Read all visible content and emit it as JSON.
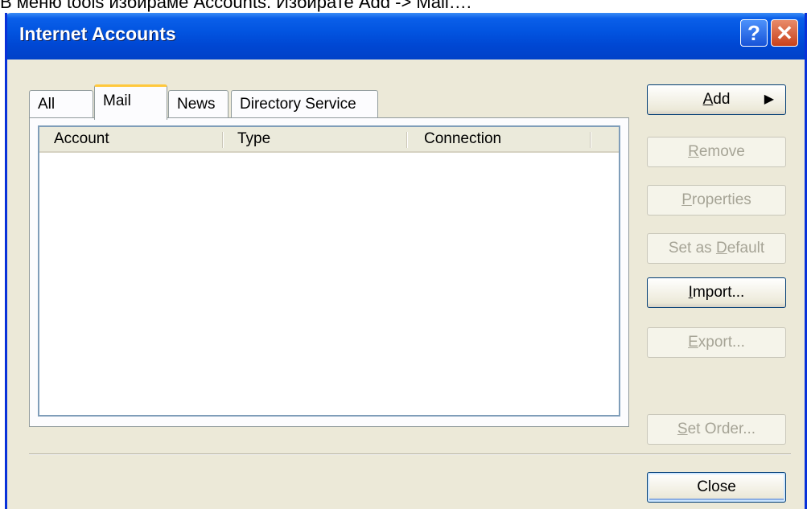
{
  "caption": "В меню tools избираме Accounts. Избирате Add -> Mail….",
  "window": {
    "title": "Internet Accounts",
    "help_glyph": "?",
    "close_glyph": "✕"
  },
  "tabs": [
    {
      "label": "All",
      "active": false
    },
    {
      "label": "Mail",
      "active": true
    },
    {
      "label": "News",
      "active": false
    },
    {
      "label": "Directory Service",
      "active": false
    }
  ],
  "list": {
    "columns": [
      "Account",
      "Type",
      "Connection"
    ],
    "rows": []
  },
  "buttons": {
    "add": {
      "label": "Add",
      "mnemonic": "A",
      "rest": "dd",
      "arrow": "▶",
      "enabled": true
    },
    "remove": {
      "mnemonic": "R",
      "rest": "emove",
      "enabled": false
    },
    "properties": {
      "mnemonic": "P",
      "rest": "roperties",
      "enabled": false
    },
    "set_default": {
      "prefix": "Set as ",
      "mnemonic": "D",
      "rest": "efault",
      "enabled": false
    },
    "import": {
      "mnemonic": "I",
      "rest": "mport...",
      "enabled": true
    },
    "export": {
      "mnemonic": "E",
      "rest": "xport...",
      "enabled": false
    },
    "set_order": {
      "mnemonic": "S",
      "rest": "et Order...",
      "enabled": false
    },
    "close": {
      "label": "Close",
      "enabled": true
    }
  }
}
